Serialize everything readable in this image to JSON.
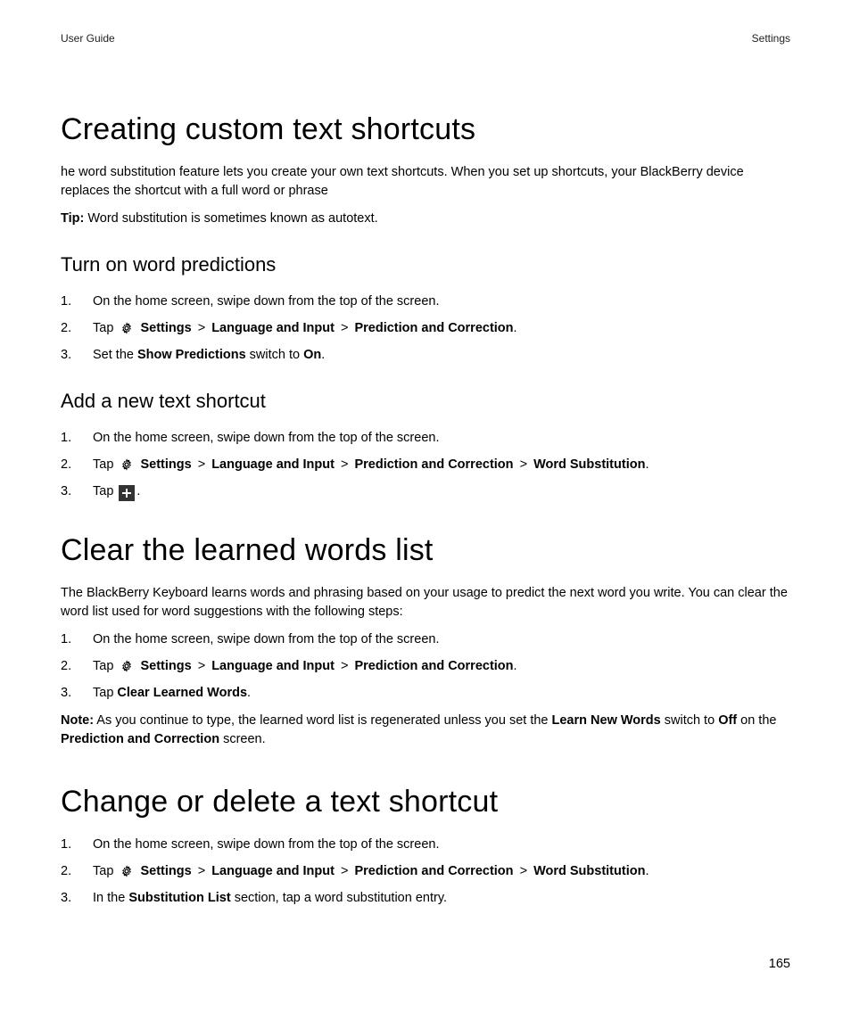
{
  "header": {
    "left": "User Guide",
    "right": "Settings"
  },
  "page_number": "165",
  "s1": {
    "title": "Creating custom text shortcuts",
    "intro": "he word substitution feature lets you create your own text shortcuts. When you set up shortcuts, your BlackBerry device replaces the shortcut with a full word or phrase",
    "tip_label": "Tip:",
    "tip_text": " Word substitution is sometimes known as autotext.",
    "sub1": {
      "title": "Turn on word predictions",
      "li1": "On the home screen, swipe down from the top of the screen.",
      "li2_pre": "Tap ",
      "li2_settings": "Settings",
      "li2_lang": "Language and Input",
      "li2_pred": "Prediction and Correction",
      "li3_a": "Set the ",
      "li3_b": "Show Predictions",
      "li3_c": " switch to ",
      "li3_d": "On",
      "li3_e": "."
    },
    "sub2": {
      "title": "Add a new text shortcut",
      "li1": "On the home screen, swipe down from the top of the screen.",
      "li2_pre": "Tap ",
      "li2_settings": "Settings",
      "li2_lang": "Language and Input",
      "li2_pred": "Prediction and Correction",
      "li2_word": "Word Substitution",
      "li3_pre": "Tap ",
      "li3_post": "."
    }
  },
  "s2": {
    "title": "Clear the learned words list",
    "intro": "The BlackBerry Keyboard learns words and phrasing based on your usage to predict the next word you write. You can clear the word list used for word suggestions with the following steps:",
    "li1": "On the home screen, swipe down from the top of the screen.",
    "li2_pre": "Tap ",
    "li2_settings": "Settings",
    "li2_lang": "Language and Input",
    "li2_pred": "Prediction and Correction",
    "li3_a": "Tap ",
    "li3_b": "Clear Learned Words",
    "li3_c": ".",
    "note_label": "Note:",
    "note_a": " As you continue to type, the learned word list is regenerated unless you set the ",
    "note_b": "Learn New Words",
    "note_c": " switch to ",
    "note_d": "Off",
    "note_e": " on the ",
    "note_f": "Prediction and Correction",
    "note_g": " screen."
  },
  "s3": {
    "title": "Change or delete a text shortcut",
    "li1": "On the home screen, swipe down from the top of the screen.",
    "li2_pre": "Tap ",
    "li2_settings": "Settings",
    "li2_lang": "Language and Input",
    "li2_pred": "Prediction and Correction",
    "li2_word": "Word Substitution",
    "li3_a": "In the ",
    "li3_b": "Substitution List",
    "li3_c": " section, tap a word substitution entry."
  },
  "sep": ">",
  "nums": {
    "n1": "1.",
    "n2": "2.",
    "n3": "3."
  }
}
